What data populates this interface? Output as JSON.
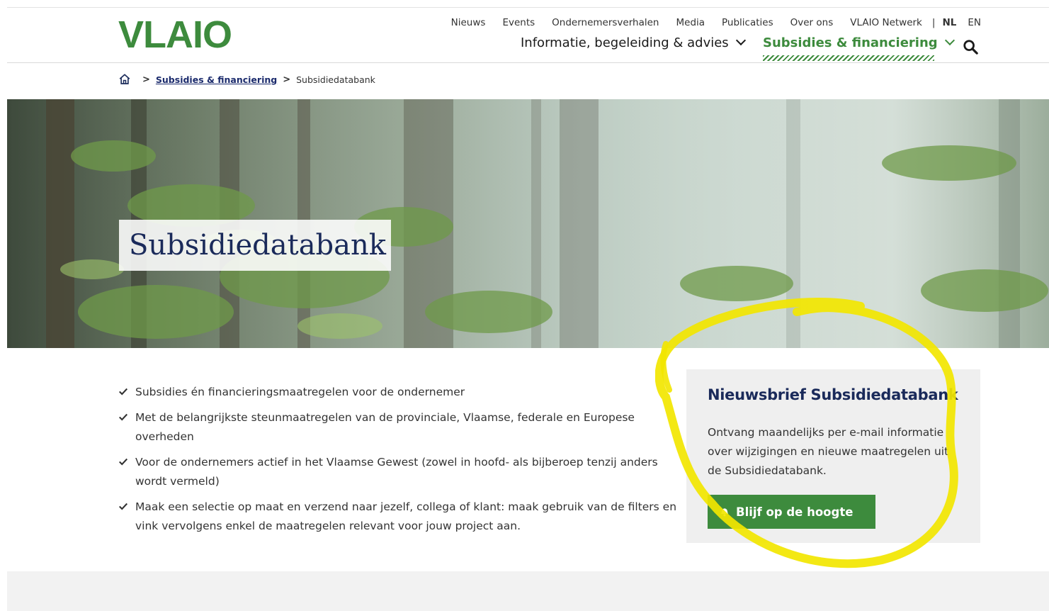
{
  "header": {
    "logo": "VLAIO",
    "util_links": [
      "Nieuws",
      "Events",
      "Ondernemersverhalen",
      "Media",
      "Publicaties",
      "Over ons",
      "VLAIO Netwerk"
    ],
    "separator": "|",
    "languages": [
      "NL",
      "EN"
    ],
    "active_language": "NL",
    "main_nav": {
      "info": "Informatie, begeleiding & advies",
      "subs": "Subsidies & financiering"
    }
  },
  "breadcrumb": {
    "link": "Subsidies & financiering",
    "current": "Subsidiedatabank"
  },
  "hero": {
    "title": "Subsidiedatabank"
  },
  "bullets": [
    "Subsidies én financieringsmaatregelen voor de ondernemer",
    "Met de belangrijkste steunmaatregelen van de provinciale, Vlaamse, federale en Europese overheden",
    "Voor de ondernemers actief in het Vlaamse Gewest (zowel in hoofd- als bijberoep tenzij anders wordt vermeld)",
    "Maak een selectie op maat en verzend naar jezelf, collega of klant: maak gebruik van de filters en vink vervolgens enkel de maatregelen relevant voor jouw project aan."
  ],
  "newsletter": {
    "title": "Nieuwsbrief Subsidiedatabank",
    "text": "Ontvang maandelijks per e-mail informatie over wijzigingen en nieuwe maatregelen uit de Subsidiedatabank.",
    "button": "Blijf op de hoogte"
  },
  "colors": {
    "brand_green": "#3d8b3d",
    "navy": "#1a2a5a",
    "highlight": "#f2e600"
  }
}
